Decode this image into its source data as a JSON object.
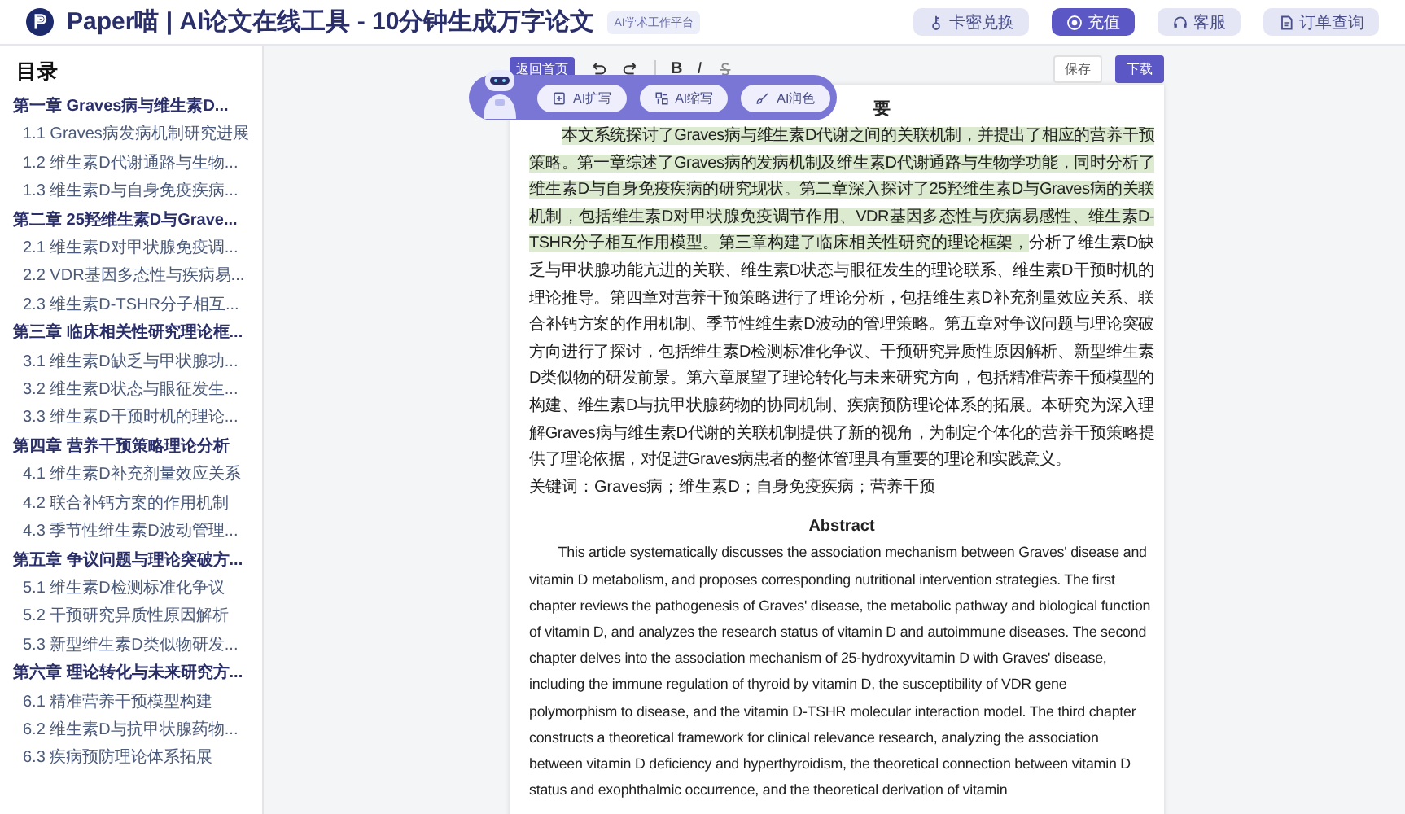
{
  "header": {
    "title": "Paper喵 | AI论文在线工具 - 10分钟生成万字论文",
    "badge": "AI学术工作平台",
    "buttons": [
      {
        "label": "卡密兑换",
        "kind": "key",
        "selected": false
      },
      {
        "label": "充值",
        "kind": "coin",
        "selected": true
      },
      {
        "label": "客服",
        "kind": "headset",
        "selected": false
      },
      {
        "label": "订单查询",
        "kind": "order",
        "selected": false
      }
    ]
  },
  "sidebar": {
    "title": "目录",
    "chapters": [
      {
        "label": "第一章 Graves病与维生素D...",
        "children": [
          {
            "label": "1.1 Graves病发病机制研究进展"
          },
          {
            "label": "1.2 维生素D代谢通路与生物..."
          },
          {
            "label": "1.3 维生素D与自身免疫疾病..."
          }
        ]
      },
      {
        "label": "第二章 25羟维生素D与Grave...",
        "children": [
          {
            "label": "2.1 维生素D对甲状腺免疫调..."
          },
          {
            "label": "2.2 VDR基因多态性与疾病易..."
          },
          {
            "label": "2.3 维生素D-TSHR分子相互..."
          }
        ]
      },
      {
        "label": "第三章 临床相关性研究理论框...",
        "children": [
          {
            "label": "3.1 维生素D缺乏与甲状腺功..."
          },
          {
            "label": "3.2 维生素D状态与眼征发生..."
          },
          {
            "label": "3.3 维生素D干预时机的理论..."
          }
        ]
      },
      {
        "label": "第四章 营养干预策略理论分析",
        "children": [
          {
            "label": "4.1 维生素D补充剂量效应关系"
          },
          {
            "label": "4.2 联合补钙方案的作用机制"
          },
          {
            "label": "4.3 季节性维生素D波动管理..."
          }
        ]
      },
      {
        "label": "第五章 争议问题与理论突破方...",
        "children": [
          {
            "label": "5.1 维生素D检测标准化争议"
          },
          {
            "label": "5.2 干预研究异质性原因解析"
          },
          {
            "label": "5.3 新型维生素D类似物研发..."
          }
        ]
      },
      {
        "label": "第六章 理论转化与未来研究方...",
        "children": [
          {
            "label": "6.1 精准营养干预模型构建"
          },
          {
            "label": "6.2 维生素D与抗甲状腺药物..."
          },
          {
            "label": "6.3 疾病预防理论体系拓展"
          }
        ]
      }
    ]
  },
  "toolbar": {
    "home_button": "返回首页",
    "bold": "B",
    "italic": "I",
    "save_button": "保存",
    "download_button": "下载"
  },
  "ai_bar": {
    "buttons": [
      {
        "label": "AI扩写",
        "kind": "expand"
      },
      {
        "label": "AI缩写",
        "kind": "shrink"
      },
      {
        "label": "AI润色",
        "kind": "polish"
      }
    ]
  },
  "document": {
    "heading": "要",
    "paragraph": [
      {
        "text": "本文系统探讨了Graves病与维生素D代谢之间的关联机制，并提出了相应的营养干预策略。第一章综述了Graves病的发病机制及维生素D代谢通路与生物学功能，同时分析了维生素D与自身免疫疾病的研究现状。第二章深入探讨了25羟维生素D与Graves病的关联机制，包括维生素D对甲状腺免疫调节作用、VDR基因多态性与疾病易感性、维生素D-TSHR分子相互作用模型。第三章构建了临床相关性研究的理论框架，",
        "highlighted": true
      },
      {
        "text": "分析了维生素D缺乏与甲状腺功能亢进的关联、维生素D状态与眼征发生的理论联系、维生素D干预时机的理论推导。第四章对营养干预策略进行了理论分析，包括维生素D补充剂量效应关系、联合补钙方案的作用机制、季节性维生素D波动的管理策略。第五章对争议问题与理论突破方向进行了探讨，包括维生素D检测标准化争议、干预研究异质性原因解析、新型维生素D类似物的研发前景。第六章展望了理论转化与未来研究方向，包括精准营养干预模型的构建、维生素D与抗甲状腺药物的协同机制、疾病预防理论体系的拓展。本研究为深入理解Graves病与维生素D代谢的关联机制提供了新的视角，为制定个体化的营养干预策略提供了理论依据，对促进Graves病患者的整体管理具有重要的理论和实践意义。",
        "highlighted": false
      }
    ],
    "keywords": "关键词：Graves病；维生素D；自身免疫疾病；营养干预",
    "abstract_heading": "Abstract",
    "abstract": "This article systematically discusses the association mechanism between Graves' disease and vitamin D metabolism, and proposes corresponding nutritional intervention strategies. The first chapter reviews the pathogenesis of Graves' disease, the metabolic pathway and biological function of vitamin D, and analyzes the research status of vitamin D and autoimmune diseases. The second chapter delves into the association mechanism of 25-hydroxyvitamin D with Graves' disease, including the immune regulation of thyroid by vitamin D, the susceptibility of VDR gene polymorphism to disease, and the vitamin D-TSHR molecular interaction model. The third chapter constructs a theoretical framework for clinical relevance research, analyzing the association between vitamin D deficiency and hyperthyroidism, the theoretical connection between vitamin D status and exophthalmic occurrence, and the theoretical derivation of vitamin"
  }
}
